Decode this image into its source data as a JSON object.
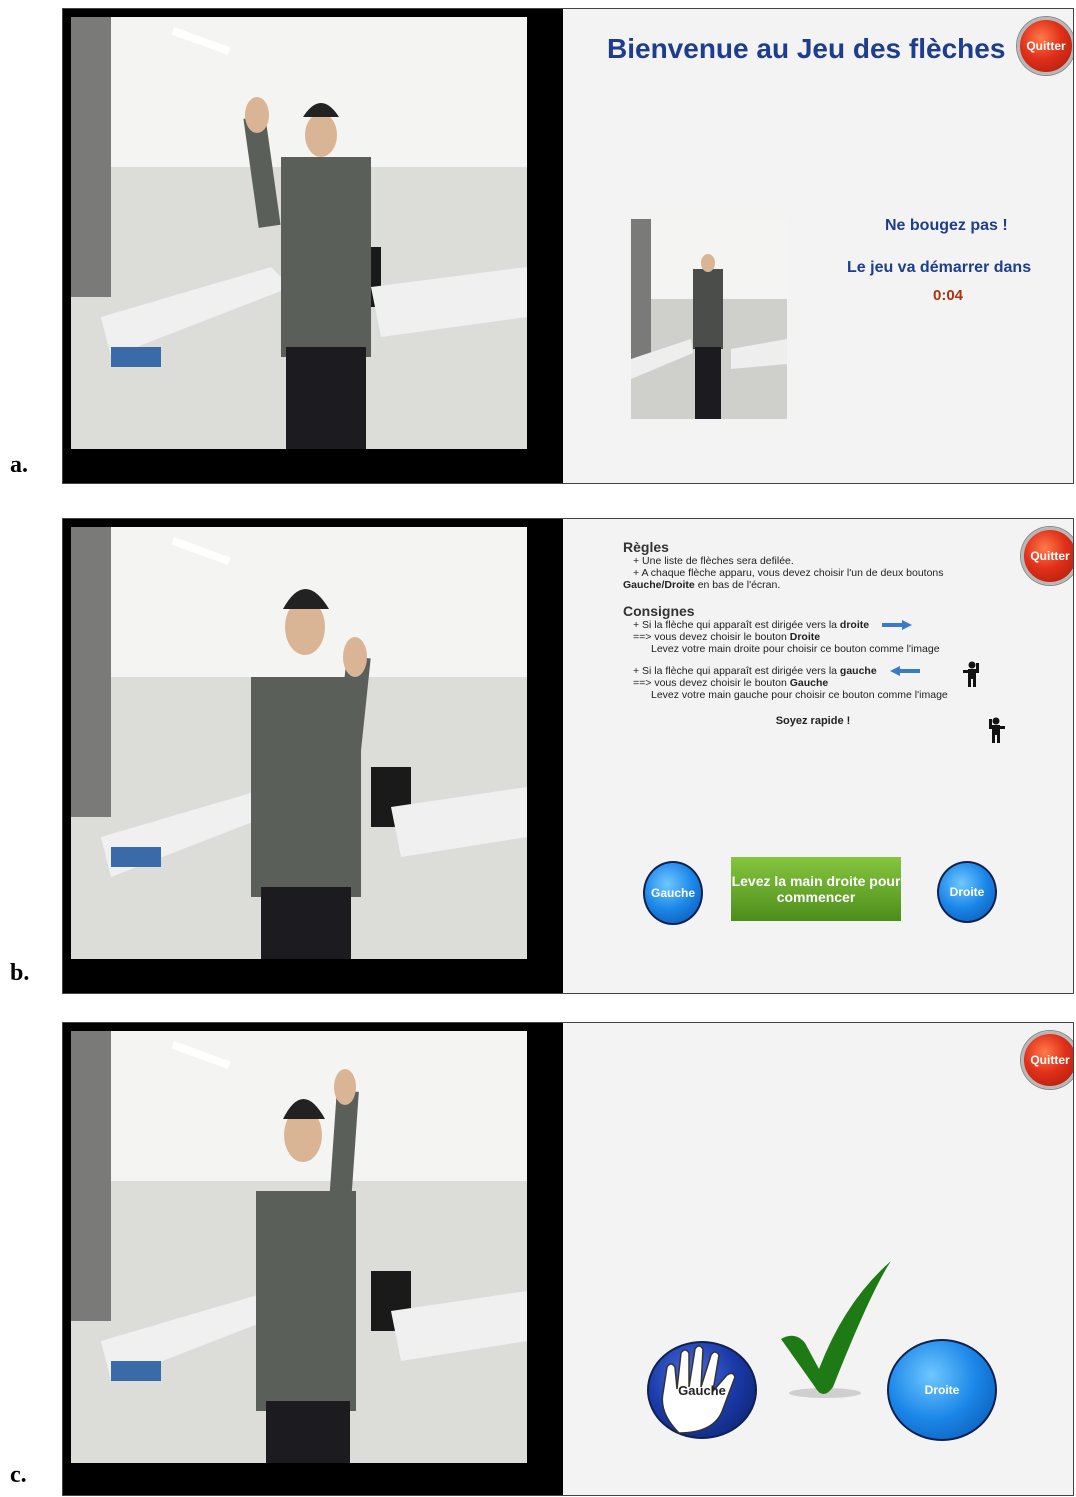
{
  "panels": [
    {
      "label": "a."
    },
    {
      "label": "b."
    },
    {
      "label": "c."
    }
  ],
  "panel_a": {
    "quit_label": "Quitter",
    "title": "Bienvenue au Jeu des flèches",
    "message": "Ne bougez pas !",
    "start_text": "Le jeu va démarrer dans",
    "countdown": "0:04"
  },
  "panel_b": {
    "quit_label": "Quitter",
    "rules_title": "Règles",
    "rule1": "+ Une liste de flèches sera defilée.",
    "rule2_a": "+ A chaque flèche apparu, vous devez choisir l'un de deux boutons",
    "rule2_b_bold": "Gauche/Droite",
    "rule2_b_rest": " en bas de l'écran.",
    "consignes_title": "Consignes",
    "c1_a": "+ Si la flèche qui apparaît est dirigée vers la ",
    "c1_bold": "droite",
    "c1_b": "==> vous devez choisir le bouton ",
    "c1_b_bold": "Droite",
    "c1_c": "Levez votre main droite pour choisir ce bouton comme l'image",
    "c2_a": "+ Si la flèche qui apparaît est dirigée vers la ",
    "c2_bold": "gauche",
    "c2_b": "==> vous devez choisir le bouton ",
    "c2_b_bold": "Gauche",
    "c2_c": "Levez votre main gauche  pour choisir ce bouton comme l'image",
    "hurry": "Soyez rapide !",
    "left_button": "Gauche",
    "start_button": "Levez la main droite pour commencer",
    "right_button": "Droite"
  },
  "panel_c": {
    "quit_label": "Quitter",
    "left_button": "Gauche",
    "right_button": "Droite"
  },
  "colors": {
    "title_blue": "#1e3d8f",
    "quit_red": "#e0301a",
    "button_blue": "#1a86e8",
    "start_green": "#6aa82e",
    "check_green": "#1e7a14"
  }
}
